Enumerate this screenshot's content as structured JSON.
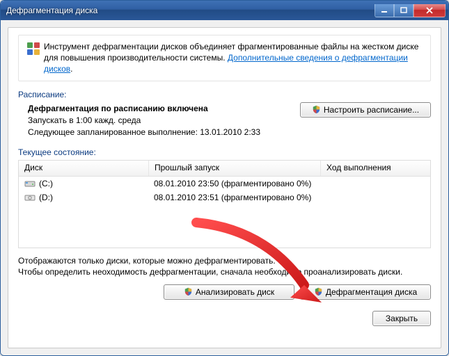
{
  "window": {
    "title": "Дефрагментация диска"
  },
  "intro": {
    "text": "Инструмент дефрагментации дисков объединяет фрагментированные файлы на жестком диске для повышения производительности системы. ",
    "link": "Дополнительные сведения о дефрагментации дисков"
  },
  "sections": {
    "schedule": "Расписание:",
    "current": "Текущее состояние:"
  },
  "schedule": {
    "enabled": "Дефрагментация по расписанию включена",
    "run_at": "Запускать в 1:00 кажд. среда",
    "next_run": "Следующее запланированное выполнение: 13.01.2010 2:33",
    "configure_button": "Настроить расписание..."
  },
  "table": {
    "headers": {
      "disk": "Диск",
      "last_run": "Прошлый запуск",
      "progress": "Ход выполнения"
    },
    "rows": [
      {
        "label": "(C:)",
        "icon": "hdd",
        "last_run": "08.01.2010 23:50 (фрагментировано 0%)",
        "progress": ""
      },
      {
        "label": "(D:)",
        "icon": "cd",
        "last_run": "08.01.2010 23:51 (фрагментировано 0%)",
        "progress": ""
      }
    ]
  },
  "note": {
    "line1": "Отображаются только диски, которые можно дефрагментировать.",
    "line2": "Чтобы определить неоходимость  дефрагментации, сначала необходимо проанализировать диски."
  },
  "buttons": {
    "analyze": "Анализировать диск",
    "defrag": "Дефрагментация диска",
    "close": "Закрыть"
  },
  "colors": {
    "link": "#0066cc",
    "heading": "#0a3a80"
  }
}
